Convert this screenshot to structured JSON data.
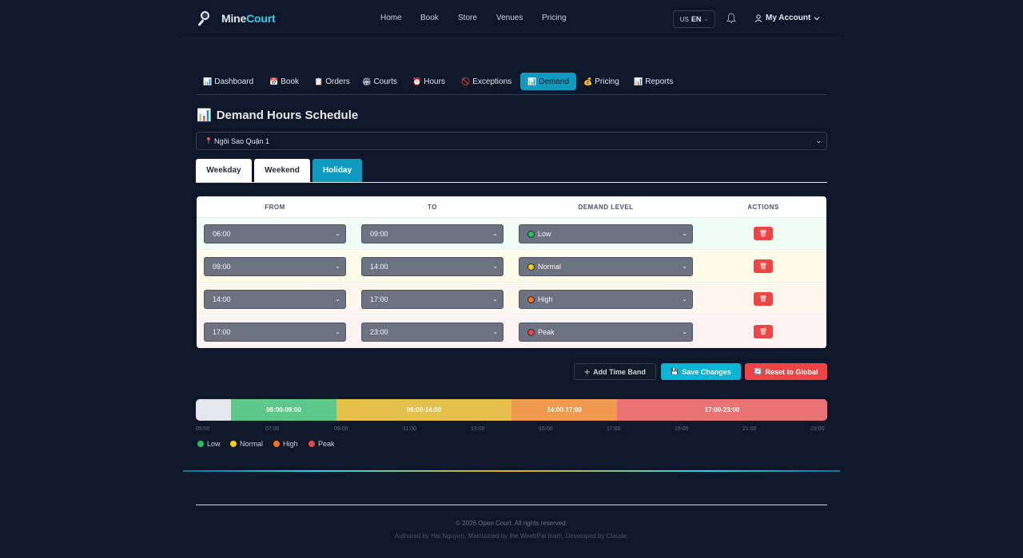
{
  "brand": {
    "name_part1": "Mine",
    "name_part2": "Court"
  },
  "topnav": {
    "home": "Home",
    "book": "Book",
    "store": "Store",
    "venues": "Venues",
    "pricing": "Pricing"
  },
  "lang": {
    "flag": "US",
    "code": "EN"
  },
  "account": {
    "label": "My Account"
  },
  "admin_tabs": [
    {
      "icon": "📊",
      "label": "Dashboard"
    },
    {
      "icon": "📅",
      "label": "Book"
    },
    {
      "icon": "📋",
      "label": "Orders"
    },
    {
      "icon": "🏟",
      "label": "Courts"
    },
    {
      "icon": "⏰",
      "label": "Hours"
    },
    {
      "icon": "🚫",
      "label": "Exceptions"
    },
    {
      "icon": "📊",
      "label": "Demand"
    },
    {
      "icon": "💰",
      "label": "Pricing"
    },
    {
      "icon": "📊",
      "label": "Reports"
    }
  ],
  "page": {
    "title_icon": "📊",
    "title": "Demand Hours Schedule"
  },
  "venue": {
    "icon": "📍",
    "selected": "Ngôi Sao Quận 1"
  },
  "day_tabs": [
    "Weekday",
    "Weekend",
    "Holiday"
  ],
  "active_day_tab": "Holiday",
  "table": {
    "headers": [
      "FROM",
      "TO",
      "DEMAND LEVEL",
      "ACTIONS"
    ],
    "rows": [
      {
        "from": "06:00",
        "to": "09:00",
        "level": "Low",
        "dot": "#22c55e",
        "bg": "#f0fdf4"
      },
      {
        "from": "09:00",
        "to": "14:00",
        "level": "Normal",
        "dot": "#facc15",
        "bg": "#fefce8"
      },
      {
        "from": "14:00",
        "to": "17:00",
        "level": "High",
        "dot": "#f97316",
        "bg": "#fff7ed"
      },
      {
        "from": "17:00",
        "to": "23:00",
        "level": "Peak",
        "dot": "#ef4444",
        "bg": "#fef2f2"
      }
    ],
    "delete_icon": "🗑"
  },
  "actions": {
    "add_label": "Add Time Band",
    "save_icon": "💾",
    "save_label": "Save Changes",
    "reset_icon": "🔄",
    "reset_label": "Reset to Global"
  },
  "timeline": {
    "segments": [
      {
        "label": "06:00-09:00",
        "color": "#5cc98a"
      },
      {
        "label": "09:00-14:00",
        "color": "#e5c04a"
      },
      {
        "label": "14:00-17:00",
        "color": "#ef9a4f"
      },
      {
        "label": "17:00-23:00",
        "color": "#e97373"
      }
    ],
    "ticks": [
      "05:00",
      "07:00",
      "09:00",
      "11:00",
      "13:00",
      "15:00",
      "17:00",
      "19:00",
      "21:00",
      "23:00"
    ]
  },
  "legend": [
    {
      "label": "Low",
      "color": "#22c55e"
    },
    {
      "label": "Normal",
      "color": "#facc15"
    },
    {
      "label": "High",
      "color": "#f97316"
    },
    {
      "label": "Peak",
      "color": "#ef4444"
    }
  ],
  "footer": {
    "copyright": "© 2026 Open Court. All rights reserved.",
    "credits": "Authored by Hai Nguyen, Maintained by the WeebPal team, Developed by Claude."
  }
}
